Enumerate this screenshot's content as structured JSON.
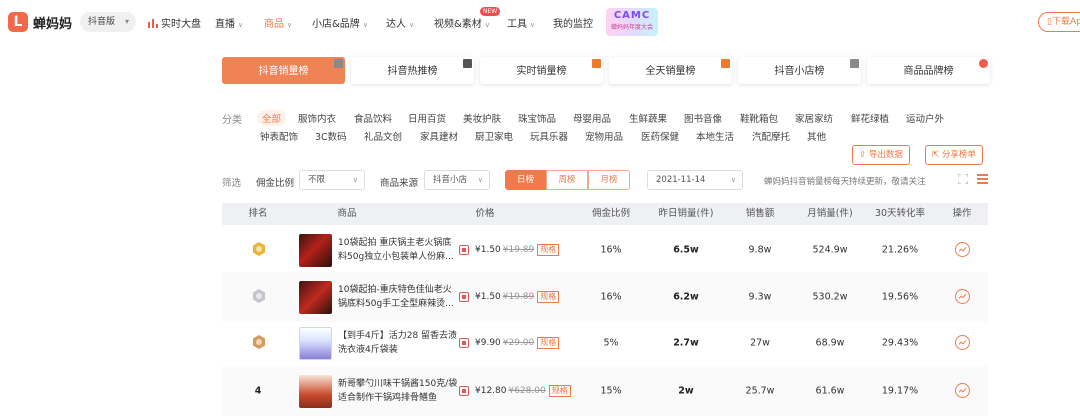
{
  "header": {
    "logo_mark": "L",
    "logo_text": "蝉妈妈",
    "platform": "抖音版",
    "nav": [
      {
        "label": "实时大盘"
      },
      {
        "label": "直播"
      },
      {
        "label": "商品"
      },
      {
        "label": "小店&品牌"
      },
      {
        "label": "达人"
      },
      {
        "label": "视频&素材"
      },
      {
        "label": "工具"
      },
      {
        "label": "我的监控"
      }
    ],
    "new_badge": "NEW",
    "banner_big": "CAMC",
    "banner_small": "蝉妈妈年度大会",
    "download": "下载App"
  },
  "tabs": [
    "抖音销量榜",
    "抖音热推榜",
    "实时销量榜",
    "全天销量榜",
    "抖音小店榜",
    "商品品牌榜"
  ],
  "tab_corner_colors": [
    "#8a8a8a",
    "#555555",
    "#f07a2a",
    "#f07a2a",
    "#8a8a8a",
    "#f05a4a"
  ],
  "categories": {
    "label": "分类",
    "items": [
      "全部",
      "服饰内衣",
      "食品饮料",
      "日用百货",
      "美妆护肤",
      "珠宝饰品",
      "母婴用品",
      "生鲜蔬果",
      "图书音像",
      "鞋靴箱包",
      "家居家纺",
      "鲜花绿植",
      "运动户外",
      "钟表配饰",
      "3C数码",
      "礼品文创",
      "家具建材",
      "厨卫家电",
      "玩具乐器",
      "宠物用品",
      "医药保健",
      "本地生活",
      "汽配摩托",
      "其他"
    ]
  },
  "actions": {
    "export": "导出数据",
    "share": "分享榜单"
  },
  "filters": {
    "label": "筛选",
    "commission_label": "佣金比例",
    "commission_value": "不限",
    "source_label": "商品来源",
    "source_value": "抖音小店",
    "periods": [
      "日榜",
      "周榜",
      "月榜"
    ],
    "date": "2021-11-14",
    "notice": "蝉妈妈抖音销量榜每天持续更新，敬请关注"
  },
  "table": {
    "headers": [
      "排名",
      "商品",
      "价格",
      "佣金比例",
      "昨日销量(件)",
      "销售额",
      "月销量(件)",
      "30天转化率",
      "操作"
    ],
    "rows": [
      {
        "rank": "",
        "medal": "gold",
        "name": "10袋起拍 重庆锅主老火锅底料50g独立小包装单人份麻...",
        "price": "¥1.50",
        "orig_price": "¥19.89",
        "tag": "规格",
        "commission": "16%",
        "yesterday": "6.5w",
        "sales": "9.8w",
        "monthly": "524.9w",
        "conversion": "21.26%"
      },
      {
        "rank": "",
        "medal": "silver",
        "name": "10袋起拍-重庆特色佳仙老火锅底料50g手工全型麻辣烫...",
        "price": "¥1.50",
        "orig_price": "¥19.89",
        "tag": "规格",
        "commission": "16%",
        "yesterday": "6.2w",
        "sales": "9.3w",
        "monthly": "530.2w",
        "conversion": "19.56%"
      },
      {
        "rank": "",
        "medal": "bronze",
        "name": "【到手4斤】活力28 留香去渍洗衣液4斤袋装",
        "price": "¥9.90",
        "orig_price": "¥29.00",
        "tag": "规格",
        "commission": "5%",
        "yesterday": "2.7w",
        "sales": "27w",
        "monthly": "68.9w",
        "conversion": "29.43%"
      },
      {
        "rank": "4",
        "medal": "",
        "name": "新哥攀勺川味干锅酱150克/袋适合制作干锅鸡排骨鳝鱼",
        "price": "¥12.80",
        "orig_price": "¥628.00",
        "tag": "规格",
        "commission": "15%",
        "yesterday": "2w",
        "sales": "25.7w",
        "monthly": "61.6w",
        "conversion": "19.17%"
      }
    ]
  },
  "colors": {
    "accent": "#f07a4c",
    "tab_active": "#f08356",
    "gold": "#e9b43a",
    "silver": "#c2c6cc",
    "bronze": "#d69a5a"
  }
}
